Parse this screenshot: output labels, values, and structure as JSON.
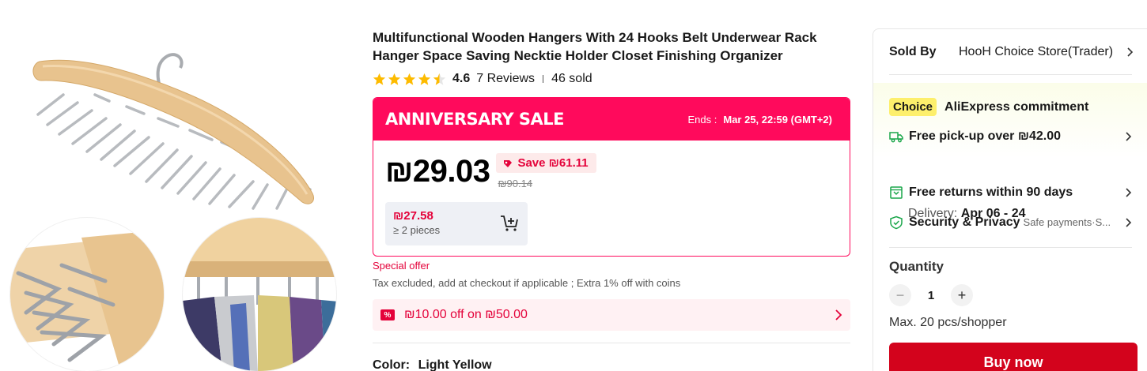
{
  "product": {
    "title": "Multifunctional Wooden Hangers With 24 Hooks Belt Underwear Rack Hanger Space Saving Necktie Holder Closet Finishing Organizer",
    "rating": "4.6",
    "rating_stars": 4.5,
    "reviews": "7 Reviews",
    "sold": "46 sold"
  },
  "sale": {
    "title": "ANNIVERSARY SALE",
    "ends_label": "Ends :",
    "ends_time": "Mar 25, 22:59 (GMT+2)",
    "price": "₪29.03",
    "save": "Save ₪61.11",
    "original_price": "₪90.14",
    "bulk_price": "₪27.58",
    "bulk_qty": "≥ 2 pieces"
  },
  "offers": {
    "special": "Special offer",
    "tax": "Tax excluded, add at checkout if applicable ; Extra 1% off with coins",
    "coupon": "₪10.00 off on ₪50.00"
  },
  "variant": {
    "label": "Color:",
    "value": "Light Yellow"
  },
  "panel": {
    "sold_by_label": "Sold By",
    "store": "HooH Choice Store(Trader)",
    "choice_badge": "Choice",
    "commitment": "AliExpress commitment",
    "pickup": "Free pick-up over ₪42.00",
    "delivery_label": "Delivery:",
    "delivery_dates": "Apr 06 - 24",
    "returns": "Free returns within 90 days",
    "security": "Security & Privacy",
    "security_sub": "Safe payments·S...",
    "quantity_label": "Quantity",
    "quantity_value": "1",
    "qty_minus": "−",
    "qty_plus": "+",
    "max": "Max. 20 pcs/shopper",
    "buy_now": "Buy now"
  },
  "colors": {
    "sale_pink": "#ff0a5c",
    "price_red": "#e4023a",
    "buy_red": "#d3031c",
    "choice_yellow": "#fdef6c",
    "commit_green": "#1aa64a",
    "star_gold": "#fdbb00"
  },
  "icons": [
    "star-icon",
    "cart-add-icon",
    "coupon-icon",
    "chevron-right-icon",
    "truck-icon",
    "return-icon",
    "shield-icon",
    "price-drop-icon"
  ]
}
